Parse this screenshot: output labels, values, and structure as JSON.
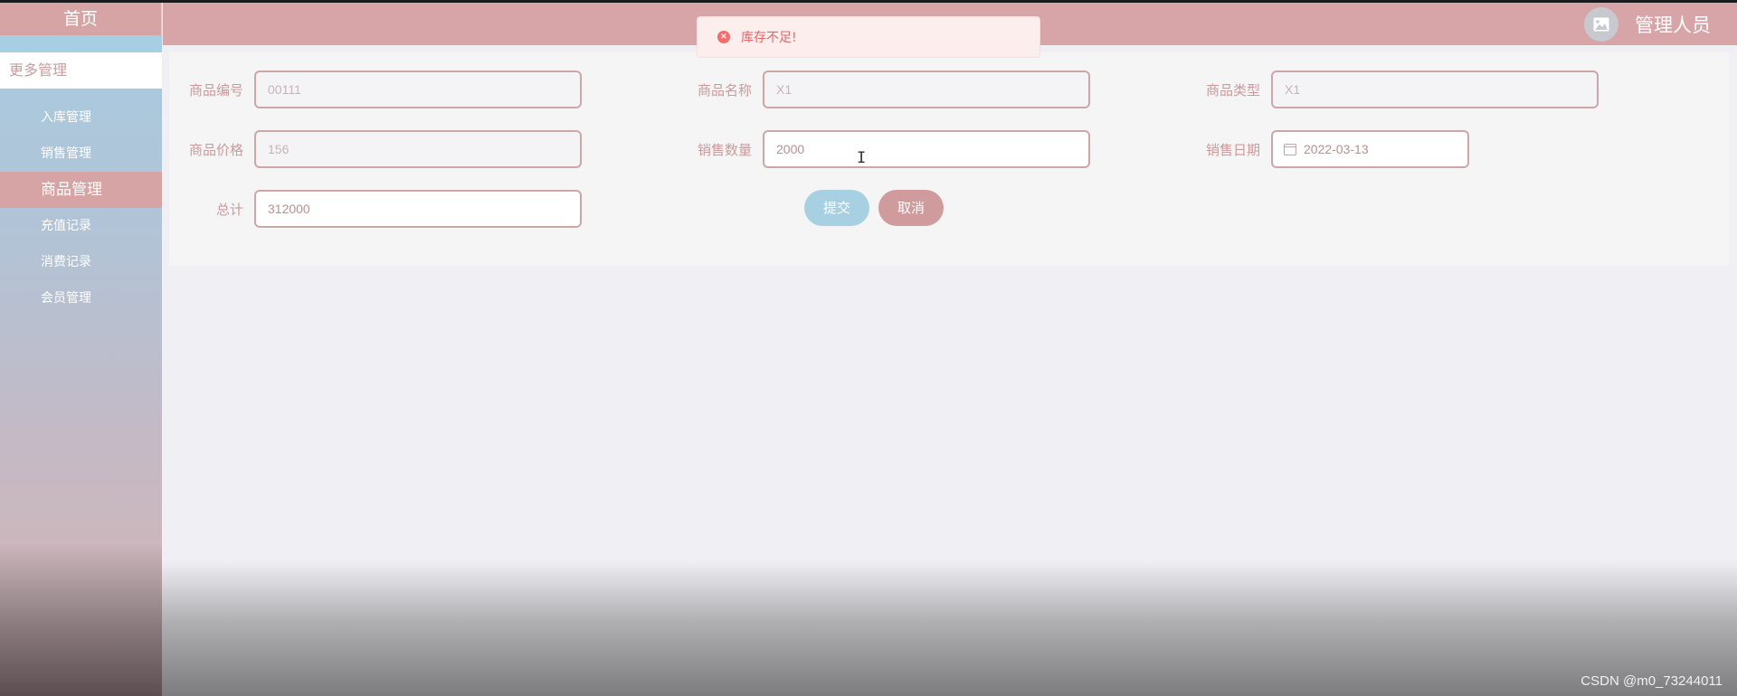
{
  "sidebar": {
    "home": "首页",
    "more": "更多管理",
    "items": [
      {
        "label": "入库管理"
      },
      {
        "label": "销售管理"
      },
      {
        "label": "商品管理"
      },
      {
        "label": "充值记录"
      },
      {
        "label": "消费记录"
      },
      {
        "label": "会员管理"
      }
    ]
  },
  "header": {
    "user": "管理人员"
  },
  "toast": {
    "message": "库存不足!"
  },
  "form": {
    "code": {
      "label": "商品编号",
      "value": "00111"
    },
    "name": {
      "label": "商品名称",
      "value": "X1"
    },
    "type": {
      "label": "商品类型",
      "value": "X1"
    },
    "price": {
      "label": "商品价格",
      "value": "156"
    },
    "qty": {
      "label": "销售数量",
      "value": "2000"
    },
    "date": {
      "label": "销售日期",
      "value": "2022-03-13"
    },
    "total": {
      "label": "总计",
      "value": "312000"
    },
    "submit": "提交",
    "cancel": "取消"
  },
  "watermark": "CSDN @m0_73244011"
}
